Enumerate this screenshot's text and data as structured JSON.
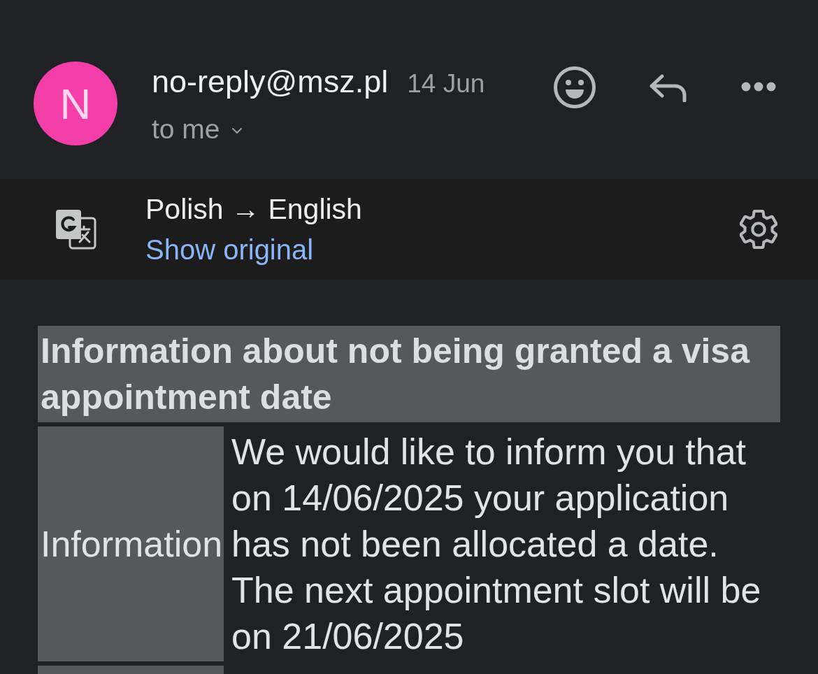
{
  "message_header": {
    "avatar_letter": "N",
    "sender": "no-reply@msz.pl",
    "date": "14 Jun",
    "recipient": "to me"
  },
  "translation_bar": {
    "languages": "Polish → English",
    "action": "Show original"
  },
  "email_body": {
    "title": "Information about not being granted a visa appointment date",
    "rows": [
      {
        "label": "Information",
        "text": "We would like to inform you that on 14/06/2025 your application has not been allocated a date. The next appointment slot will be on 21/06/2025"
      }
    ]
  }
}
